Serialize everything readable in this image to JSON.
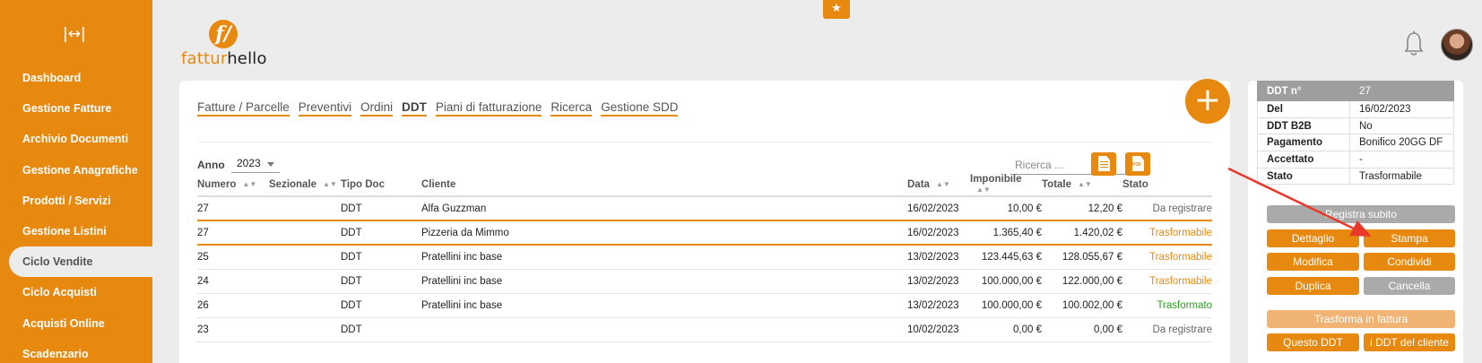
{
  "sidebar": {
    "collapse_label": "|↔|",
    "items": [
      {
        "label": "Dashboard"
      },
      {
        "label": "Gestione Fatture"
      },
      {
        "label": "Archivio Documenti"
      },
      {
        "label": "Gestione Anagrafiche"
      },
      {
        "label": "Prodotti / Servizi"
      },
      {
        "label": "Gestione Listini"
      },
      {
        "label": "Ciclo Vendite"
      },
      {
        "label": "Ciclo Acquisti"
      },
      {
        "label": "Acquisti Online"
      },
      {
        "label": "Scadenzario"
      }
    ]
  },
  "brand": {
    "mark": "f/",
    "name_a": "fattur",
    "name_b": "hello"
  },
  "header": {
    "star_icon": "★"
  },
  "tabs": [
    {
      "label": "Fatture / Parcelle"
    },
    {
      "label": "Preventivi"
    },
    {
      "label": "Ordini"
    },
    {
      "label": "DDT"
    },
    {
      "label": "Piani di fatturazione"
    },
    {
      "label": "Ricerca"
    },
    {
      "label": "Gestione SDD"
    }
  ],
  "fab_label": "+",
  "filters": {
    "anno_label": "Anno",
    "anno_value": "2023",
    "search_placeholder": "Ricerca ...",
    "pdf_label": "PDF"
  },
  "table": {
    "sort_icon": "▲▼",
    "columns": {
      "numero": "Numero",
      "sezionale": "Sezionale",
      "tipo": "Tipo Doc",
      "cliente": "Cliente",
      "data": "Data",
      "imponibile": "Imponibile",
      "totale": "Totale",
      "stato": "Stato"
    },
    "rows": [
      {
        "numero": "27",
        "sezionale": "",
        "tipo": "DDT",
        "cliente": "Alfa Guzzman",
        "data": "16/02/2023",
        "imponibile": "10,00 €",
        "totale": "12,20 €",
        "stato": "Da registrare"
      },
      {
        "numero": "27",
        "sezionale": "",
        "tipo": "DDT",
        "cliente": "Pizzeria da Mimmo",
        "data": "16/02/2023",
        "imponibile": "1.365,40 €",
        "totale": "1.420,02 €",
        "stato": "Trasformabile"
      },
      {
        "numero": "25",
        "sezionale": "",
        "tipo": "DDT",
        "cliente": "Pratellini inc base",
        "data": "13/02/2023",
        "imponibile": "123.445,63 €",
        "totale": "128.055,67 €",
        "stato": "Trasformabile"
      },
      {
        "numero": "24",
        "sezionale": "",
        "tipo": "DDT",
        "cliente": "Pratellini inc base",
        "data": "13/02/2023",
        "imponibile": "100.000,00 €",
        "totale": "122.000,00 €",
        "stato": "Trasformabile"
      },
      {
        "numero": "26",
        "sezionale": "",
        "tipo": "DDT",
        "cliente": "Pratellini inc base",
        "data": "13/02/2023",
        "imponibile": "100.000,00 €",
        "totale": "100.002,00 €",
        "stato": "Trasformato"
      },
      {
        "numero": "23",
        "sezionale": "",
        "tipo": "DDT",
        "cliente": "",
        "data": "10/02/2023",
        "imponibile": "0,00 €",
        "totale": "0,00 €",
        "stato": "Da registrare"
      }
    ]
  },
  "detail": {
    "rows": [
      {
        "key": "DDT n°",
        "value": "27"
      },
      {
        "key": "Del",
        "value": "16/02/2023"
      },
      {
        "key": "DDT B2B",
        "value": "No"
      },
      {
        "key": "Pagamento",
        "value": "Bonifico 20GG DF"
      },
      {
        "key": "Accettato",
        "value": "-"
      },
      {
        "key": "Stato",
        "value": "Trasformabile"
      }
    ],
    "buttons": {
      "registra": "Registra subito",
      "dettaglio": "Dettaglio",
      "stampa": "Stampa",
      "modifica": "Modifica",
      "condividi": "Condividi",
      "duplica": "Duplica",
      "cancella": "Cancella",
      "trasforma": "Trasforma in fattura",
      "questo": "Questo DDT",
      "cliente": "i DDT del cliente"
    }
  },
  "colors": {
    "accent": "#e8890f",
    "annotation_arrow": "#e8392a",
    "status_green": "#2a9d1d"
  }
}
